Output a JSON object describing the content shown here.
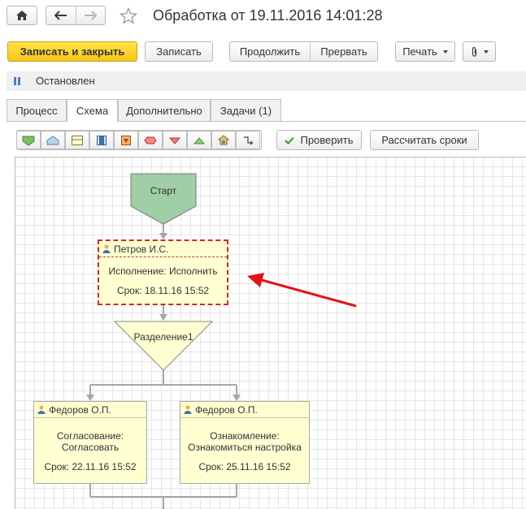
{
  "window": {
    "title": "Обработка от 19.11.2016 14:01:28"
  },
  "commands": {
    "save_close": "Записать и закрыть",
    "save": "Записать",
    "continue": "Продолжить",
    "abort": "Прервать",
    "print": "Печать"
  },
  "status": {
    "text": "Остановлен"
  },
  "tabs": [
    {
      "label": "Процесс"
    },
    {
      "label": "Схема"
    },
    {
      "label": "Дополнительно"
    },
    {
      "label": "Задачи (1)"
    }
  ],
  "active_tab": "Схема",
  "scheme_toolbar": {
    "check": "Проверить",
    "calc": "Рассчитать сроки",
    "tools": [
      "action-point-icon",
      "start-point-icon",
      "subprocess-icon",
      "function-icon",
      "end-point-icon",
      "condition-icon",
      "split-icon",
      "merge-icon",
      "gear-icon",
      "connect-icon"
    ]
  },
  "diagram": {
    "start": {
      "label": "Старт"
    },
    "task1": {
      "user": "Петров И.С.",
      "action": "Исполнение: Исполнить",
      "due": "Срок: 18.11.16 15:52"
    },
    "split": {
      "label": "Разделение1"
    },
    "task2": {
      "user": "Федоров О.П.",
      "action_line1": "Согласование:",
      "action_line2": "Согласовать",
      "due": "Срок: 22.11.16 15:52"
    },
    "task3": {
      "user": "Федоров О.П.",
      "action_line1": "Ознакомление:",
      "action_line2": "Ознакомиться настройка",
      "due": "Срок: 25.11.16 15:52"
    }
  },
  "colors": {
    "accent": "#f6c61a",
    "start_fill": "#9fcea7",
    "task_fill": "#ffffd2",
    "highlight": "#c0302e",
    "arrow": "#e0141a"
  }
}
